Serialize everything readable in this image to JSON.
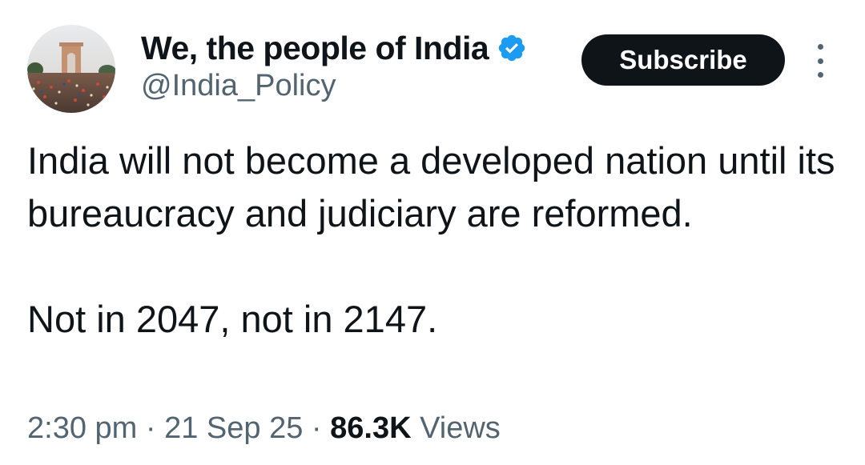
{
  "author": {
    "display_name": "We, the people of India",
    "handle": "@India_Policy",
    "verified": true,
    "verified_color": "#1d9bf0"
  },
  "header": {
    "subscribe_label": "Subscribe",
    "more_icon": "more-vertical-icon"
  },
  "tweet": {
    "paragraph_1": "India will not become a developed nation until its bureaucracy and judiciary are reformed.",
    "paragraph_2": "Not in 2047, not in 2147."
  },
  "meta": {
    "time": "2:30 pm",
    "separator": "·",
    "date": "21 Sep 25",
    "views_count": "86.3K",
    "views_label": "Views"
  },
  "colors": {
    "text_primary": "#0f1419",
    "text_secondary": "#536471",
    "button_bg": "#0f1419",
    "button_text": "#ffffff"
  }
}
